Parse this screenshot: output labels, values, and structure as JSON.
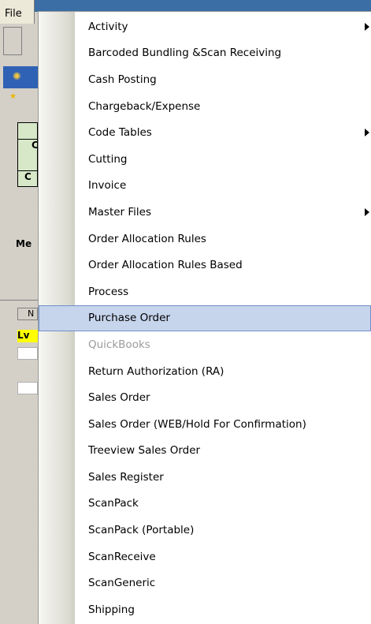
{
  "menubar": {
    "file_label": "File"
  },
  "background_fragments": [
    "C",
    "C",
    "Me",
    "N",
    "Lv"
  ],
  "menu": {
    "items": [
      {
        "label": "Activity",
        "submenu": true
      },
      {
        "label": "Barcoded Bundling &Scan Receiving"
      },
      {
        "label": "Cash Posting"
      },
      {
        "label": "Chargeback/Expense"
      },
      {
        "label": "Code Tables",
        "submenu": true
      },
      {
        "label": "Cutting"
      },
      {
        "label": "Invoice"
      },
      {
        "label": "Master Files",
        "submenu": true
      },
      {
        "label": "Order Allocation Rules"
      },
      {
        "label": "Order Allocation Rules Based"
      },
      {
        "label": "Process"
      },
      {
        "label": "Purchase Order",
        "highlighted": true
      },
      {
        "label": "QuickBooks",
        "disabled": true
      },
      {
        "label": "Return Authorization (RA)"
      },
      {
        "label": "Sales Order"
      },
      {
        "label": "Sales Order (WEB/Hold For Confirmation)"
      },
      {
        "label": "Treeview Sales Order"
      },
      {
        "label": "Sales Register"
      },
      {
        "label": "ScanPack"
      },
      {
        "label": "ScanPack (Portable)"
      },
      {
        "label": "ScanReceive"
      },
      {
        "label": "ScanGeneric"
      },
      {
        "label": "Shipping"
      }
    ]
  }
}
